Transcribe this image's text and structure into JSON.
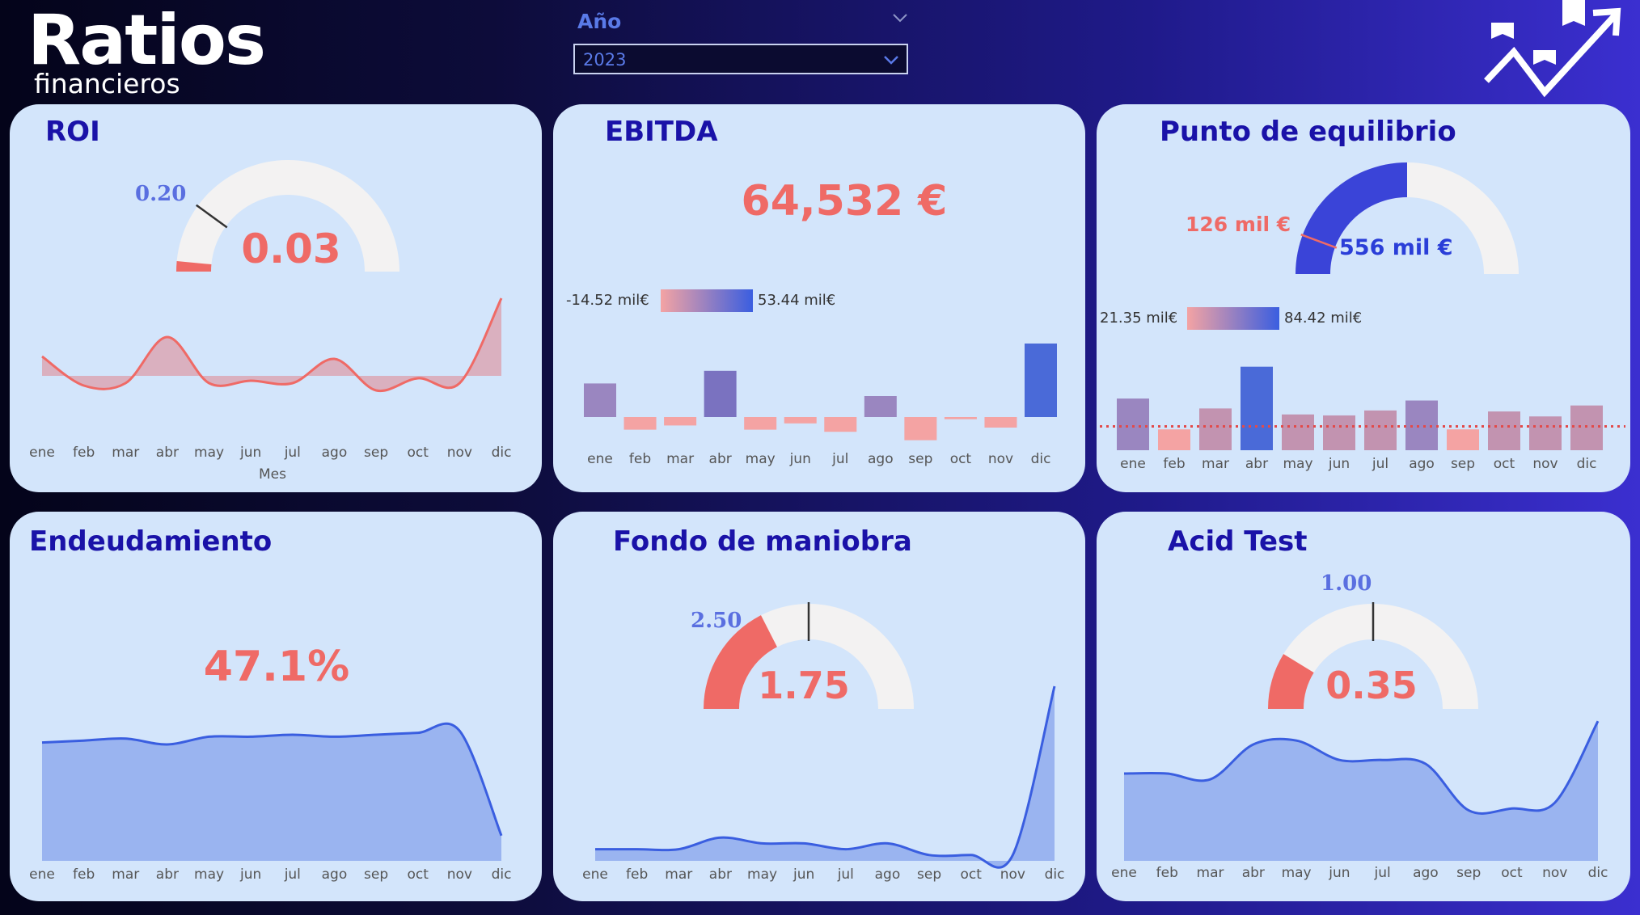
{
  "header": {
    "title": "Ratios",
    "subtitle": "financieros"
  },
  "filter": {
    "label": "Año",
    "value": "2023"
  },
  "icons": {
    "logo": "bar-chart-growth-arrow-icon",
    "chevron": "chevron-down-icon"
  },
  "colors": {
    "accent_red": "#ef6a66",
    "accent_blue": "#3a5ee0",
    "card_bg": "#d3e5fb",
    "title": "#1a12a8",
    "area_blue": "#9ab4f0"
  },
  "months": [
    "ene",
    "feb",
    "mar",
    "abr",
    "may",
    "jun",
    "jul",
    "ago",
    "sep",
    "oct",
    "nov",
    "dic"
  ],
  "cards": {
    "roi": {
      "title": "ROI",
      "value": "0.03",
      "target": "0.20",
      "axis_label": "Mes",
      "gauge": {
        "min": 0,
        "max": 1,
        "value": 0.03,
        "target": 0.2
      },
      "series": [
        0.14,
        0.02,
        0.03,
        0.22,
        0.03,
        0.04,
        0.03,
        0.13,
        0.0,
        0.05,
        0.03,
        0.38
      ],
      "baseline": 0.06
    },
    "ebitda": {
      "title": "EBITDA",
      "value": "64,532 €",
      "legend_min": "-14.52 mil€",
      "legend_max": "53.44 mil€",
      "series": [
        16,
        -6,
        -4,
        22,
        -6,
        -3,
        -7,
        10,
        -11,
        -1,
        -5,
        35
      ]
    },
    "punto": {
      "title": "Punto de equilibrio",
      "value": "556 mil €",
      "target": "126 mil €",
      "gauge": {
        "min": 0,
        "max": 1112,
        "value": 556,
        "target": 126
      },
      "legend_min": "21.35 mil€",
      "legend_max": "84.42 mil€",
      "series": [
        52,
        21,
        42,
        84,
        36,
        35,
        40,
        50,
        21,
        39,
        34,
        45
      ],
      "reference_line": 24
    },
    "endeudamiento": {
      "title": "Endeudamiento",
      "value": "47.1%",
      "series": [
        0.61,
        0.62,
        0.63,
        0.6,
        0.64,
        0.64,
        0.65,
        0.64,
        0.65,
        0.66,
        0.67,
        0.13
      ]
    },
    "fondo": {
      "title": "Fondo de maniobra",
      "value": "1.75",
      "target": "2.50",
      "gauge": {
        "min": 0,
        "max": 5,
        "value": 1.75,
        "target": 2.5
      },
      "series": [
        0.1,
        0.1,
        0.1,
        0.2,
        0.15,
        0.15,
        0.1,
        0.15,
        0.05,
        0.05,
        0.05,
        1.5
      ]
    },
    "acid": {
      "title": "Acid Test",
      "value": "0.35",
      "target": "1.00",
      "gauge": {
        "min": 0,
        "max": 2,
        "value": 0.35,
        "target": 1.0
      },
      "series": [
        0.45,
        0.45,
        0.42,
        0.6,
        0.62,
        0.52,
        0.52,
        0.5,
        0.26,
        0.27,
        0.3,
        0.72
      ]
    }
  }
}
